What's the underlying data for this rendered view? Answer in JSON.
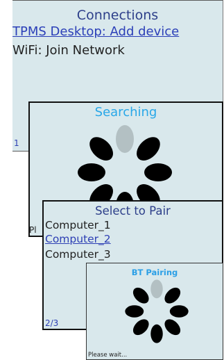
{
  "connections": {
    "title": "Connections",
    "items": [
      "TPMS Desktop: Add device",
      "WiFi: Join Network"
    ],
    "page_indicator": "1"
  },
  "searching": {
    "title": "Searching",
    "footer": "Pl"
  },
  "select_pair": {
    "title": "Select to Pair",
    "items": [
      "Computer_1",
      "Computer_2",
      "Computer_3"
    ],
    "page_indicator": "2/3"
  },
  "bt_pairing": {
    "title": "BT Pairing",
    "footer": "Please wait..."
  },
  "colors": {
    "screen_bg": "#d9e8ec",
    "title_dark": "#2d3f8a",
    "title_light": "#28a7e8",
    "link": "#2b3fb8",
    "spinner_active": "#b3c0c3",
    "spinner_dot": "#000000"
  }
}
